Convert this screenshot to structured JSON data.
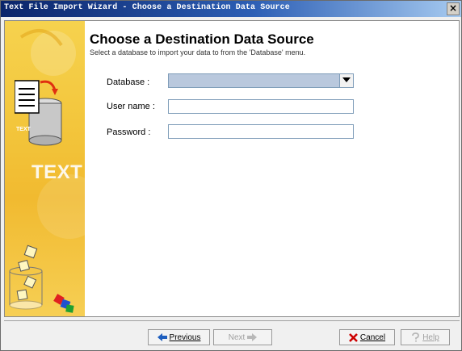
{
  "window": {
    "title": "Text File Import Wizard - Choose a Destination Data Source",
    "close_symbol": "×"
  },
  "sidebar": {
    "graphic_text": "TEXT",
    "doc_label": "TEXT",
    "icons": [
      "document-to-database-icon",
      "filter-cylinder-icon"
    ]
  },
  "page": {
    "heading": "Choose a Destination Data Source",
    "subheading": "Select a database to import your data to from the 'Database' menu."
  },
  "form": {
    "database_label": "Database :",
    "database_value": "",
    "username_label": "User name :",
    "username_value": "",
    "password_label": "Password :",
    "password_value": ""
  },
  "buttons": {
    "previous": "Previous",
    "next": "Next",
    "cancel": "Cancel",
    "help": "Help"
  },
  "colors": {
    "title_bar": "#0a246a",
    "sidebar": "#f3c63c",
    "select_fill": "#b9c8dd",
    "cancel_icon": "#cc0000",
    "nav_arrow": "#1f5fbf"
  }
}
